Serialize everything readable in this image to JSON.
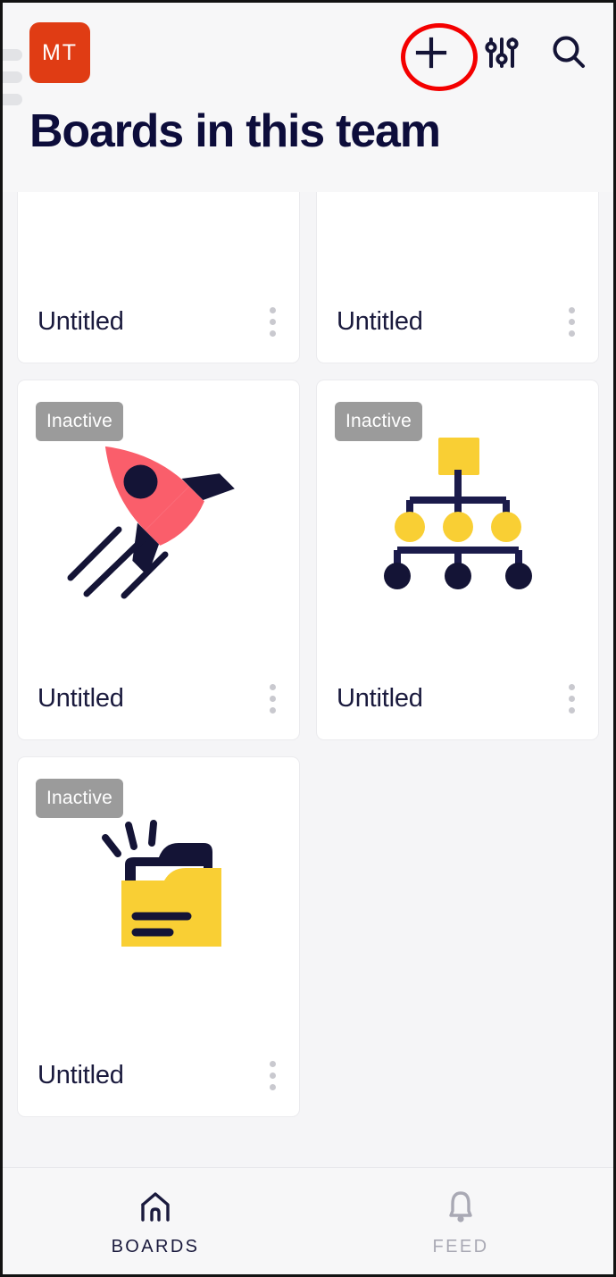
{
  "header": {
    "drawer_handle_icon": "hamburger-handle-icon",
    "avatar_initials": "MT",
    "avatar_color": "#e03c14",
    "title": "Boards in this team",
    "actions": [
      {
        "name": "add-board-button",
        "icon": "plus-icon",
        "highlight": true,
        "highlight_color": "#f40000"
      },
      {
        "name": "filter-button",
        "icon": "sliders-icon"
      },
      {
        "name": "search-button",
        "icon": "search-icon"
      }
    ]
  },
  "boards": {
    "cards": [
      {
        "title": "Untitled",
        "badge": "",
        "art": "cursor-leaf-illustration",
        "menu_icon": "kebab-menu-icon",
        "clipped_top": true
      },
      {
        "title": "Untitled",
        "badge": "",
        "art": "sticky-note-illustration",
        "menu_icon": "kebab-menu-icon",
        "clipped_top": true
      },
      {
        "title": "Untitled",
        "badge": "Inactive",
        "art": "rocket-illustration",
        "menu_icon": "kebab-menu-icon",
        "clipped_top": false
      },
      {
        "title": "Untitled",
        "badge": "Inactive",
        "art": "org-chart-illustration",
        "menu_icon": "kebab-menu-icon",
        "clipped_top": false
      },
      {
        "title": "Untitled",
        "badge": "Inactive",
        "art": "folder-illustration",
        "menu_icon": "kebab-menu-icon",
        "clipped_top": false
      }
    ],
    "badge_color": "#9b9b9b"
  },
  "bottom_nav": {
    "items": [
      {
        "label": "BOARDS",
        "icon": "home-icon",
        "active": true
      },
      {
        "label": "FEED",
        "icon": "bell-icon",
        "active": false
      }
    ]
  },
  "colors": {
    "navy": "#141436",
    "yellow": "#f9cf34",
    "coral": "#fa5e6b",
    "blue": "#3f5fe0",
    "page_bg": "#f5f5f7"
  }
}
